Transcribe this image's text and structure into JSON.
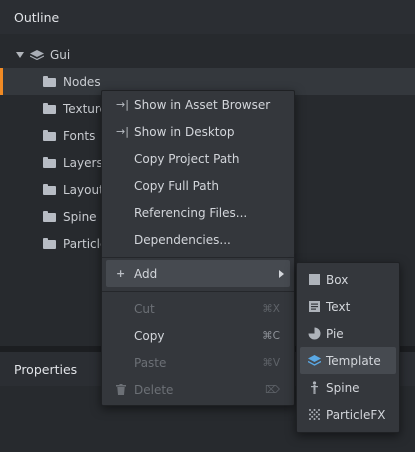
{
  "outline": {
    "title": "Outline",
    "tree": {
      "root": "Gui",
      "items": [
        "Nodes",
        "Textures",
        "Fonts",
        "Layers",
        "Layouts",
        "Spine Scenes",
        "Particle FX"
      ]
    }
  },
  "properties": {
    "title": "Properties"
  },
  "context_menu": {
    "items": [
      {
        "label": "Show in Asset Browser",
        "lead": "→|"
      },
      {
        "label": "Show in Desktop",
        "lead": "→|"
      },
      {
        "label": "Copy Project Path"
      },
      {
        "label": "Copy Full Path"
      },
      {
        "label": "Referencing Files..."
      },
      {
        "label": "Dependencies..."
      }
    ],
    "add": {
      "label": "Add",
      "lead": "+"
    },
    "edit_items": [
      {
        "label": "Cut",
        "shortcut": "⌘X",
        "disabled": true
      },
      {
        "label": "Copy",
        "shortcut": "⌘C",
        "disabled": false
      },
      {
        "label": "Paste",
        "shortcut": "⌘V",
        "disabled": true
      },
      {
        "label": "Delete",
        "shortcut": "⌦",
        "disabled": true
      }
    ]
  },
  "add_submenu": {
    "items": [
      {
        "label": "Box",
        "icon": "box-icon"
      },
      {
        "label": "Text",
        "icon": "text-icon"
      },
      {
        "label": "Pie",
        "icon": "pie-icon"
      },
      {
        "label": "Template",
        "icon": "template-icon"
      },
      {
        "label": "Spine",
        "icon": "spine-icon"
      },
      {
        "label": "ParticleFX",
        "icon": "particlefx-icon"
      }
    ]
  },
  "colors": {
    "selection_accent": "#f08a24",
    "add_icon": "#4aa3ea",
    "template_icon": "#5aa9e6"
  }
}
